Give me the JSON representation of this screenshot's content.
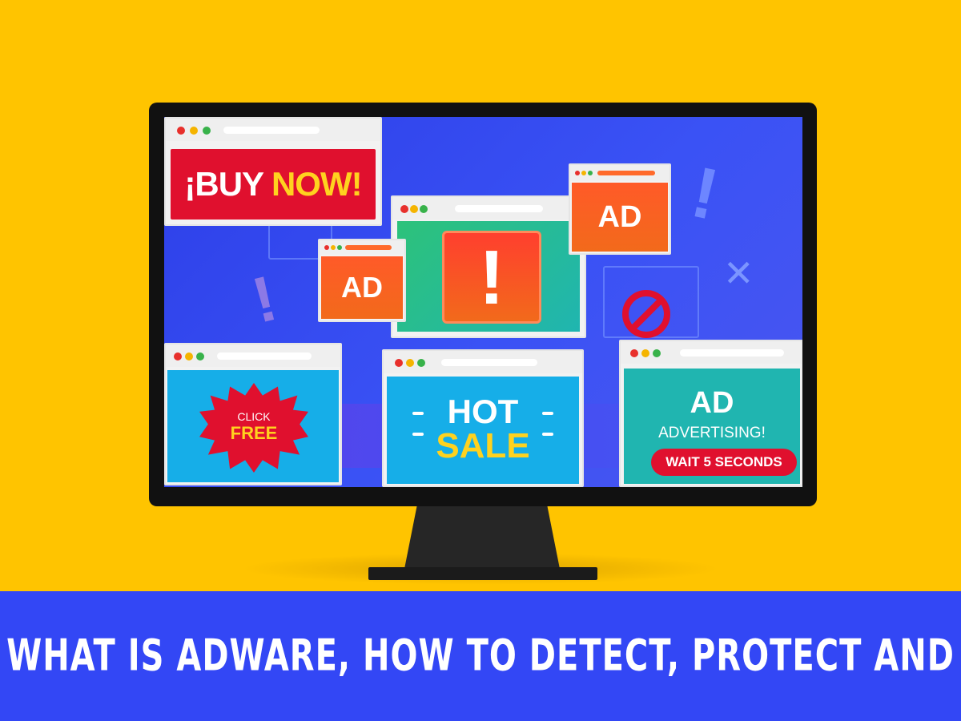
{
  "ads": {
    "buy_now_prefix": "¡BUY ",
    "buy_now_suffix": "NOW!",
    "ad_label_1": "AD",
    "ad_label_2": "AD",
    "alert_mark": "!",
    "click_line": "CLICK",
    "free_line": "FREE",
    "hot_line": "HOT",
    "sale_line": "SALE",
    "ad_label_3": "AD",
    "advertising": "ADVERTISING!",
    "wait": "WAIT 5 SECONDS"
  },
  "decor": {
    "exclamation": "!",
    "cross": "✕"
  },
  "caption": "WHAT IS ADWARE, HOW TO DETECT, PROTECT AND REMOVE",
  "colors": {
    "background": "#FFC400",
    "caption_bar": "#3347F5",
    "screen": "#3A52F5",
    "ad_red": "#E0102E",
    "ad_orange": "#F26A1B",
    "ad_cyan": "#16AEE8",
    "ad_teal": "#20B5B0",
    "text_yellow": "#FFD21F"
  }
}
